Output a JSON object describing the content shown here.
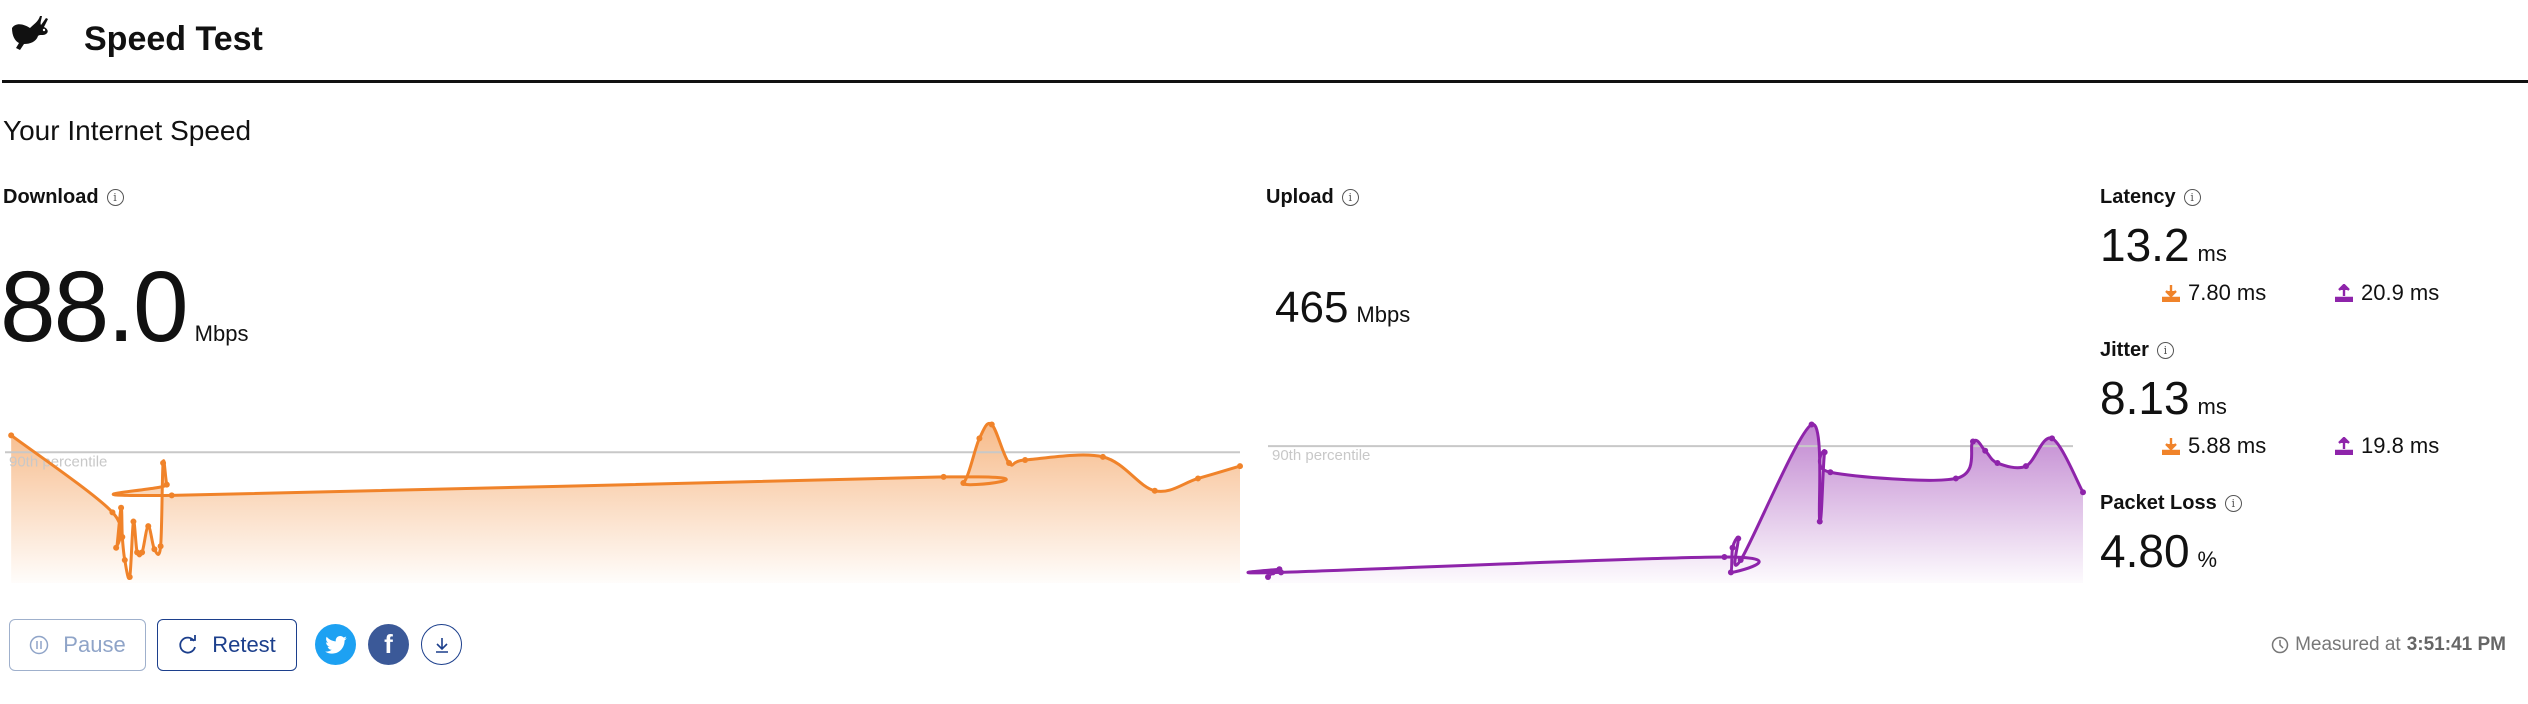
{
  "header": {
    "title": "Speed Test",
    "logo_icon": "rabbit-icon"
  },
  "section_title": "Your Internet Speed",
  "download": {
    "label": "Download",
    "value": "88.0",
    "unit": "Mbps",
    "color": "#f0832a"
  },
  "upload": {
    "label": "Upload",
    "value": "465",
    "unit": "Mbps",
    "color": "#8e24aa"
  },
  "latency": {
    "label": "Latency",
    "value": "13.2",
    "unit": "ms",
    "download": "7.80 ms",
    "upload": "20.9 ms"
  },
  "jitter": {
    "label": "Jitter",
    "value": "8.13",
    "unit": "ms",
    "download": "5.88 ms",
    "upload": "19.8 ms"
  },
  "packet_loss": {
    "label": "Packet Loss",
    "value": "4.80",
    "unit": "%"
  },
  "buttons": {
    "pause": "Pause",
    "retest": "Retest"
  },
  "share": {
    "twitter_icon": "twitter-icon",
    "facebook_icon": "facebook-icon",
    "save_icon": "download-icon"
  },
  "measured": {
    "prefix": "Measured at",
    "time": "3:51:41 PM"
  },
  "chart_data": [
    {
      "type": "area",
      "series_label": "Download",
      "percentile_label": "90th percentile",
      "percentile_value": 81,
      "ylim": [
        0,
        100
      ],
      "color": "#f0832a",
      "x": [
        0.5,
        8.7,
        9.0,
        9.4,
        9.5,
        9.7,
        10.1,
        10.4,
        10.7,
        11.1,
        11.6,
        12.1,
        12.6,
        12.8,
        13.1,
        13.5,
        76,
        77.6,
        78.9,
        79.9,
        81.3,
        82.6,
        88.9,
        93.1,
        96.6,
        100
      ],
      "y": [
        92,
        42,
        19,
        45,
        26,
        11,
        0,
        36,
        16,
        16,
        33,
        18,
        20,
        74,
        60,
        53,
        65,
        61,
        90,
        99,
        74,
        76,
        78,
        56,
        64,
        72
      ]
    },
    {
      "type": "area",
      "series_label": "Upload",
      "percentile_label": "90th percentile",
      "percentile_value": 85,
      "ylim": [
        0,
        100
      ],
      "color": "#8e24aa",
      "x": [
        0,
        0.6,
        1.4,
        1.6,
        56,
        56.8,
        57,
        57.7,
        58,
        66.7,
        67.7,
        68.3,
        69,
        84.4,
        86.5,
        88,
        89.5,
        93,
        96.2,
        100
      ],
      "y": [
        0,
        3,
        5,
        3,
        13,
        3,
        19,
        25,
        11,
        99,
        36,
        81,
        68,
        64,
        88,
        82,
        74,
        72,
        90,
        55
      ]
    }
  ]
}
